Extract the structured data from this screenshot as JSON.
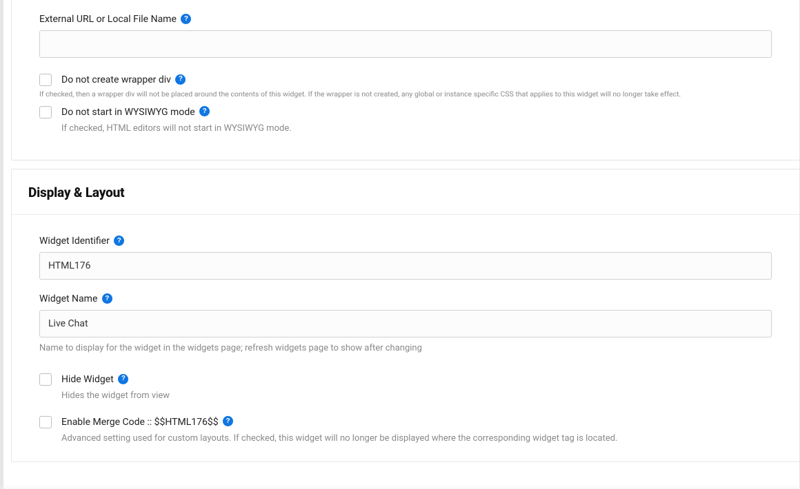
{
  "section1": {
    "externalUrl": {
      "label": "External URL or Local File Name",
      "value": ""
    },
    "wrapperDiv": {
      "label": "Do not create wrapper div",
      "note": "If checked, then a wrapper div will not be placed around the contents of this widget. If the wrapper is not created, any global or instance specific CSS that applies to this widget will no longer take effect."
    },
    "wysiwyg": {
      "label": "Do not start in WYSIWYG mode",
      "note": "If checked, HTML editors will not start in WYSIWYG mode."
    }
  },
  "section2": {
    "heading": "Display & Layout",
    "widgetIdentifier": {
      "label": "Widget Identifier",
      "value": "HTML176"
    },
    "widgetName": {
      "label": "Widget Name",
      "value": "Live Chat",
      "note": "Name to display for the widget in the widgets page; refresh widgets page to show after changing"
    },
    "hideWidget": {
      "label": "Hide Widget",
      "note": "Hides the widget from view"
    },
    "mergeCode": {
      "label": "Enable Merge Code :: $$HTML176$$",
      "note": "Advanced setting used for custom layouts. If checked, this widget will no longer be displayed where the corresponding widget tag is located."
    }
  }
}
